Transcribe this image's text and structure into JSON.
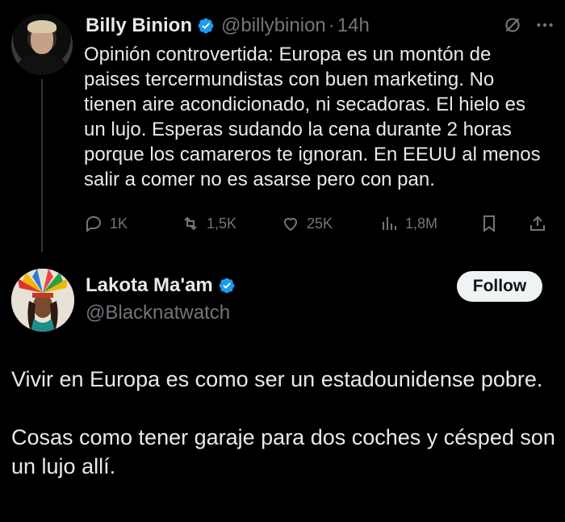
{
  "tweet": {
    "author_name": "Billy Binion",
    "handle": "@billybinion",
    "separator": "·",
    "time": "14h",
    "text": "Opinión controvertida: Europa es un montón de paises tercermundistas con buen marketing. No tienen aire acondicionado, ni secadoras. El hielo es un lujo. Esperas sudando la cena durante 2 horas porque los camareros te ignoran. En EEUU al menos salir a comer no es asarse pero con pan.",
    "stats": {
      "replies": "1K",
      "reposts": "1,5K",
      "likes": "25K",
      "views": "1,8M"
    }
  },
  "reply": {
    "author_name": "Lakota Ma'am",
    "handle": "@Blacknatwatch",
    "follow_label": "Follow",
    "paragraph1": "Vivir en Europa es como ser un estadounidense pobre.",
    "paragraph2": "Cosas como tener garaje para dos coches y césped son un lujo allí."
  },
  "colors": {
    "background": "#000000",
    "text": "#e7e9ea",
    "muted": "#71767b",
    "verified": "#1d9bf0"
  }
}
